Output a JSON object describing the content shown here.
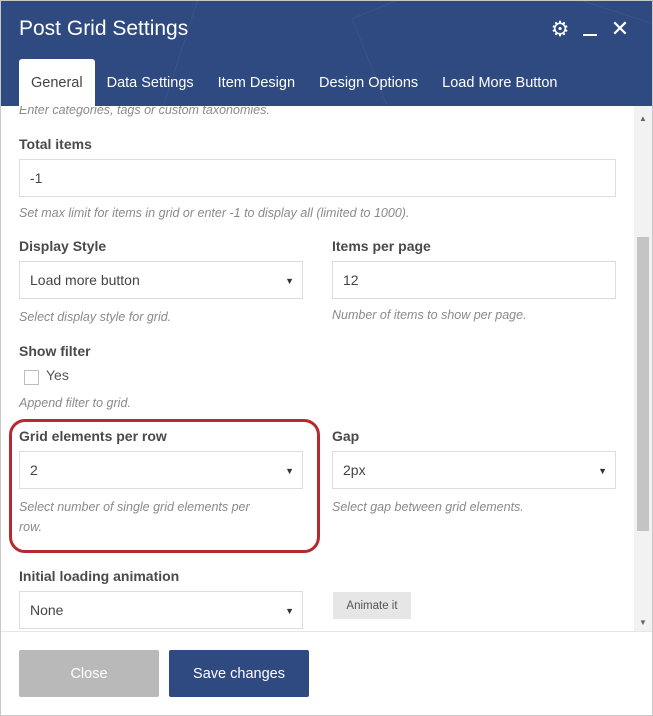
{
  "modal": {
    "title": "Post Grid Settings",
    "icons": {
      "settings": "gear-icon",
      "minimize": "minimize-icon",
      "close": "close-icon"
    },
    "colors": {
      "header": "#2f4a80",
      "highlight": "#b52a2e",
      "save_button": "#2f4a80",
      "close_button": "#b9b9b9"
    }
  },
  "tabs": [
    {
      "label": "General",
      "active": true
    },
    {
      "label": "Data Settings",
      "active": false
    },
    {
      "label": "Item Design",
      "active": false
    },
    {
      "label": "Design Options",
      "active": false
    },
    {
      "label": "Load More Button",
      "active": false
    }
  ],
  "form": {
    "top_help": "Enter categories, tags or custom taxonomies.",
    "total_items": {
      "label": "Total items",
      "value": "-1",
      "help": "Set max limit for items in grid or enter -1 to display all (limited to 1000)."
    },
    "display_style": {
      "label": "Display Style",
      "value": "Load more button",
      "help": "Select display style for grid."
    },
    "items_per_page": {
      "label": "Items per page",
      "value": "12",
      "help": "Number of items to show per page."
    },
    "show_filter": {
      "label": "Show filter",
      "checkbox_label": "Yes",
      "checked": false,
      "help": "Append filter to grid."
    },
    "grid_elements_per_row": {
      "label": "Grid elements per row",
      "value": "2",
      "help_line1": "Select number of single grid elements per",
      "help_line2": "row."
    },
    "gap": {
      "label": "Gap",
      "value": "2px",
      "help": "Select gap between grid elements."
    },
    "initial_loading_animation": {
      "label": "Initial loading animation",
      "value": "None",
      "animate_button": "Animate it"
    }
  },
  "footer": {
    "close_label": "Close",
    "save_label": "Save changes"
  }
}
